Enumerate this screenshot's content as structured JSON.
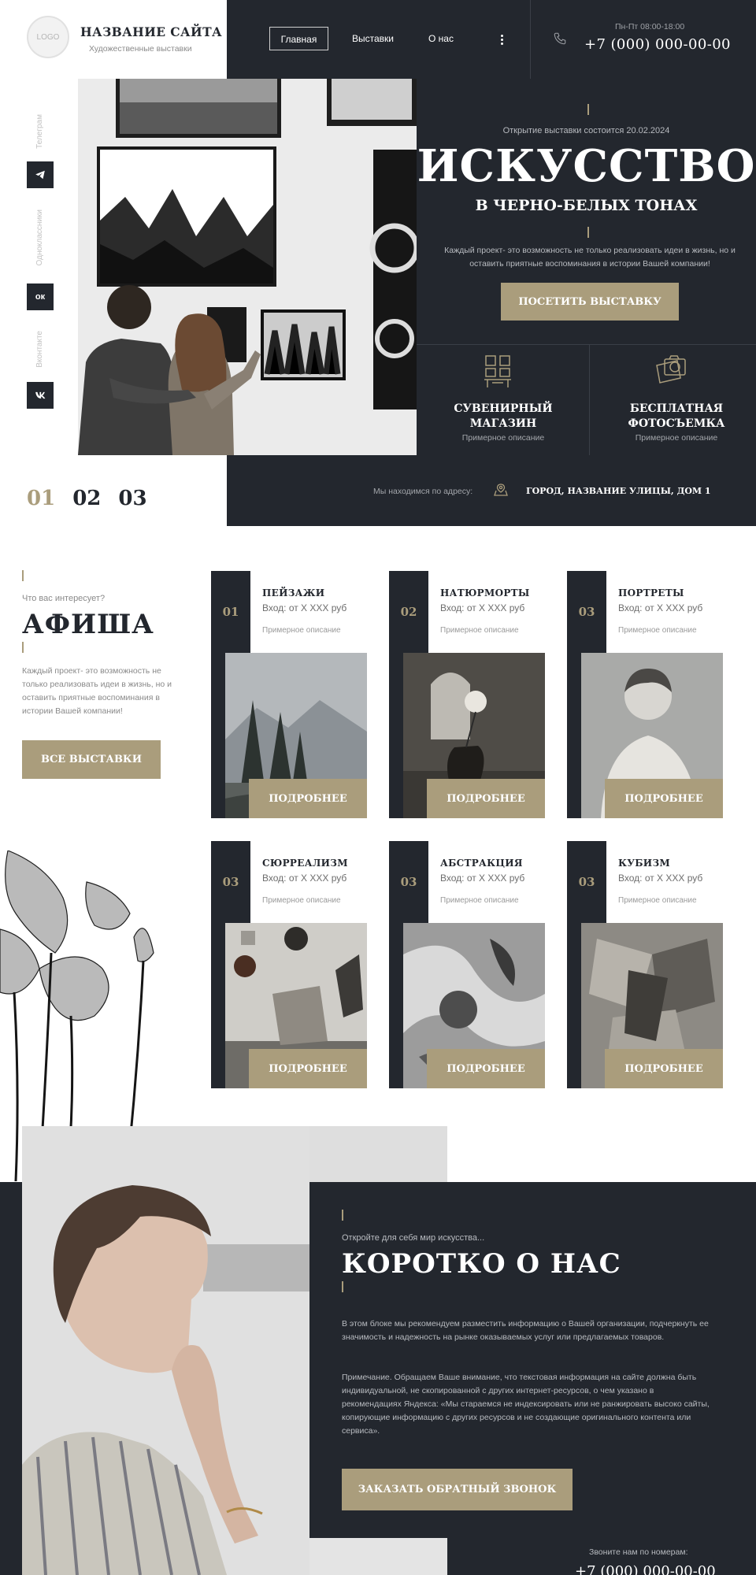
{
  "header": {
    "logo_text": "LOGO",
    "site_title": "НАЗВАНИЕ САЙТА",
    "site_subtitle": "Художественные выставки",
    "nav": [
      "Главная",
      "Выставки",
      "О нас"
    ],
    "hours": "Пн-Пт 08:00-18:00",
    "phone": "+7 (000) 000-00-00"
  },
  "socials": [
    {
      "label": "Телеграм",
      "icon": "telegram-icon"
    },
    {
      "label": "Одноклассники",
      "icon": "ok-icon",
      "glyph": "ок"
    },
    {
      "label": "Вконтакте",
      "icon": "vk-icon"
    }
  ],
  "hero": {
    "date": "Открытие выставки состоится 20.02.2024",
    "title": "ИСКУССТВО",
    "subtitle": "В ЧЕРНО-БЕЛЫХ ТОНАХ",
    "description": "Каждый проект- это возможность не только реализовать идеи в жизнь, но и оставить приятные воспоминания в истории Вашей компании!",
    "button": "ПОСЕТИТЬ ВЫСТАВКУ",
    "cards": [
      {
        "title": "СУВЕНИРНЫЙ МАГАЗИН",
        "desc": "Примерное описание",
        "icon": "shop-icon"
      },
      {
        "title": "БЕСПЛАТНАЯ ФОТОСЪЕМКА",
        "desc": "Примерное описание",
        "icon": "camera-icon"
      }
    ],
    "slides": [
      "01",
      "02",
      "03"
    ],
    "address_label": "Мы находимся по адресу:",
    "address": "ГОРОД, НАЗВАНИЕ УЛИЦЫ, ДОМ 1"
  },
  "afisha": {
    "kicker": "Что вас интересует?",
    "title": "АФИША",
    "description": "Каждый проект- это возможность не только реализовать идеи в жизнь, но и оставить приятные воспоминания в истории Вашей компании!",
    "button": "ВСЕ ВЫСТАВКИ",
    "cards": [
      {
        "num": "01",
        "title": "ПЕЙЗАЖИ",
        "price": "Вход: от Х ХХХ руб",
        "desc": "Примерное описание",
        "button": "ПОДРОБНЕЕ"
      },
      {
        "num": "02",
        "title": "НАТЮРМОРТЫ",
        "price": "Вход: от Х ХХХ руб",
        "desc": "Примерное описание",
        "button": "ПОДРОБНЕЕ"
      },
      {
        "num": "03",
        "title": "ПОРТРЕТЫ",
        "price": "Вход: от Х ХХХ руб",
        "desc": "Примерное описание",
        "button": "ПОДРОБНЕЕ"
      },
      {
        "num": "03",
        "title": "СЮРРЕАЛИЗМ",
        "price": "Вход: от Х ХХХ руб",
        "desc": "Примерное описание",
        "button": "ПОДРОБНЕЕ"
      },
      {
        "num": "03",
        "title": "АБСТРАКЦИЯ",
        "price": "Вход: от Х ХХХ руб",
        "desc": "Примерное описание",
        "button": "ПОДРОБНЕЕ"
      },
      {
        "num": "03",
        "title": "КУБИЗМ",
        "price": "Вход: от Х ХХХ руб",
        "desc": "Примерное описание",
        "button": "ПОДРОБНЕЕ"
      }
    ]
  },
  "about": {
    "kicker": "Откройте для себя мир искусства...",
    "title": "КОРОТКО О НАС",
    "p1": "В этом блоке мы рекомендуем разместить информацию о Вашей организации, подчеркнуть ее значимость и надежность на рынке оказываемых услуг или предлагаемых товаров.",
    "p2": "Примечание. Обращаем Ваше внимание, что текстовая информация на сайте должна быть индивидуальной, не скопированной с других интернет-ресурсов, о чем указано в рекомендациях Яндекса: «Мы стараемся не индексировать или не ранжировать высоко сайты, копирующие информацию с других ресурсов и не создающие оригинального контента или сервиса».",
    "button": "ЗАКАЗАТЬ ОБРАТНЫЙ ЗВОНОК",
    "call_label": "Звоните нам по номерам:",
    "phone": "+7 (000) 000-00-00"
  },
  "colors": {
    "dark": "#23272e",
    "gold": "#aa9d7c",
    "white": "#ffffff"
  }
}
